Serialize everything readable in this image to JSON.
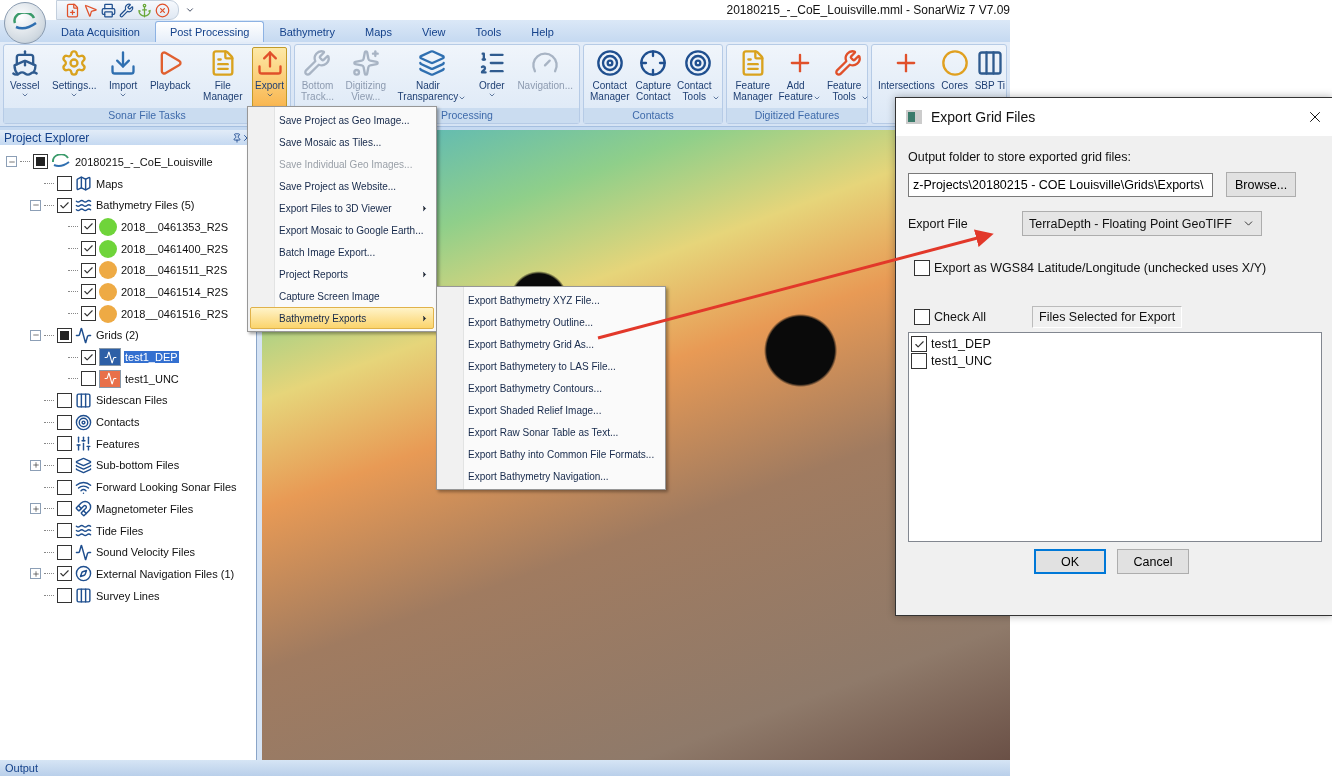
{
  "window": {
    "title": "20180215_-_CoE_Louisville.mml - SonarWiz 7 V7.09"
  },
  "tabs": [
    {
      "label": "Data Acquisition",
      "selected": false
    },
    {
      "label": "Post Processing",
      "selected": true
    },
    {
      "label": "Bathymetry",
      "selected": false
    },
    {
      "label": "Maps",
      "selected": false
    },
    {
      "label": "View",
      "selected": false
    },
    {
      "label": "Tools",
      "selected": false
    },
    {
      "label": "Help",
      "selected": false
    }
  ],
  "ribbon": [
    {
      "label": "Sonar File Tasks",
      "buttons": [
        {
          "label": "Vessel",
          "dropdown": true,
          "disabled": false,
          "active": false
        },
        {
          "label": "Settings...",
          "dropdown": true,
          "disabled": false,
          "active": false
        },
        {
          "label": "Import",
          "dropdown": true,
          "disabled": false,
          "active": false
        },
        {
          "label": "Playback",
          "dropdown": false,
          "disabled": false,
          "active": false
        },
        {
          "label": "File\nManager",
          "dropdown": false,
          "disabled": false,
          "active": false
        },
        {
          "label": "Export",
          "dropdown": true,
          "disabled": false,
          "active": true
        }
      ]
    },
    {
      "label": "Processing",
      "buttons": [
        {
          "label": "Bottom\nTrack...",
          "dropdown": false,
          "disabled": true,
          "active": false
        },
        {
          "label": "Digitizing\nView...",
          "dropdown": false,
          "disabled": true,
          "active": false
        },
        {
          "label": "Nadir\nTransparency",
          "dropdown": true,
          "disabled": false,
          "active": false
        },
        {
          "label": "Order",
          "dropdown": true,
          "disabled": false,
          "active": false
        },
        {
          "label": "Navigation...",
          "dropdown": false,
          "disabled": true,
          "active": false
        }
      ]
    },
    {
      "label": "Contacts",
      "buttons": [
        {
          "label": "Contact\nManager",
          "dropdown": false,
          "disabled": false,
          "active": false
        },
        {
          "label": "Capture\nContact",
          "dropdown": false,
          "disabled": false,
          "active": false
        },
        {
          "label": "Contact\nTools",
          "dropdown": true,
          "disabled": false,
          "active": false
        }
      ]
    },
    {
      "label": "Digitized Features",
      "buttons": [
        {
          "label": "Feature\nManager",
          "dropdown": false,
          "disabled": false,
          "active": false
        },
        {
          "label": "Add\nFeature",
          "dropdown": true,
          "disabled": false,
          "active": false
        },
        {
          "label": "Feature\nTools",
          "dropdown": true,
          "disabled": false,
          "active": false
        }
      ]
    },
    {
      "buttons": [
        {
          "label": "Intersections",
          "dropdown": false,
          "disabled": false,
          "active": false
        },
        {
          "label": "Cores",
          "dropdown": false,
          "disabled": false,
          "active": false
        },
        {
          "label": "SBP Ti",
          "dropdown": false,
          "disabled": false,
          "active": false
        }
      ]
    }
  ],
  "project_explorer": {
    "title": "Project Explorer",
    "tree": [
      {
        "label": "20180215_-_CoE_Louisville",
        "kind": "project",
        "checked": false,
        "mixed": true,
        "expanded": true,
        "selected": false,
        "children": [
          {
            "label": "Maps",
            "kind": "folder",
            "checked": false,
            "mixed": false,
            "selected": false
          },
          {
            "label": "Bathymetry Files (5)",
            "kind": "folder",
            "checked": true,
            "mixed": false,
            "expanded": true,
            "selected": false,
            "children": [
              {
                "label": "2018__0461353_R2S",
                "kind": "status",
                "color": "#6fd43a",
                "checked": true,
                "mixed": false,
                "selected": false
              },
              {
                "label": "2018__0461400_R2S",
                "kind": "status",
                "color": "#6fd43a",
                "checked": true,
                "mixed": false,
                "selected": false
              },
              {
                "label": "2018__0461511_R2S",
                "kind": "status",
                "color": "#eeaa44",
                "checked": true,
                "mixed": false,
                "selected": false
              },
              {
                "label": "2018__0461514_R2S",
                "kind": "status",
                "color": "#eeaa44",
                "checked": true,
                "mixed": false,
                "selected": false
              },
              {
                "label": "2018__0461516_R2S",
                "kind": "status",
                "color": "#eeaa44",
                "checked": true,
                "mixed": false,
                "selected": false
              }
            ]
          },
          {
            "label": "Grids (2)",
            "kind": "folder",
            "checked": false,
            "mixed": true,
            "expanded": true,
            "selected": false,
            "children": [
              {
                "label": "test1_DEP",
                "kind": "grid",
                "color": "#2d5fa6",
                "checked": true,
                "mixed": false,
                "selected": true
              },
              {
                "label": "test1_UNC",
                "kind": "grid",
                "color": "#e8704a",
                "checked": false,
                "mixed": false,
                "selected": false
              }
            ]
          },
          {
            "label": "Sidescan Files",
            "kind": "folder",
            "checked": false,
            "mixed": false,
            "selected": false
          },
          {
            "label": "Contacts",
            "kind": "folder",
            "checked": false,
            "mixed": false,
            "selected": false
          },
          {
            "label": "Features",
            "kind": "folder",
            "checked": false,
            "mixed": false,
            "selected": false
          },
          {
            "label": "Sub-bottom Files",
            "kind": "folder",
            "checked": false,
            "mixed": false,
            "expanded": false,
            "selected": false
          },
          {
            "label": "Forward Looking Sonar Files",
            "kind": "folder",
            "checked": false,
            "mixed": false,
            "selected": false
          },
          {
            "label": "Magnetometer Files",
            "kind": "folder",
            "checked": false,
            "mixed": false,
            "expanded": false,
            "selected": false
          },
          {
            "label": "Tide Files",
            "kind": "folder",
            "checked": false,
            "mixed": false,
            "selected": false
          },
          {
            "label": "Sound Velocity Files",
            "kind": "folder",
            "checked": false,
            "mixed": false,
            "selected": false
          },
          {
            "label": "External Navigation Files (1)",
            "kind": "folder",
            "checked": true,
            "mixed": false,
            "expanded": false,
            "selected": false
          },
          {
            "label": "Survey Lines",
            "kind": "folder",
            "checked": false,
            "mixed": false,
            "selected": false
          }
        ]
      }
    ]
  },
  "export_menu": [
    {
      "label": "Save Project as Geo Image...",
      "disabled": false,
      "submenu": false,
      "selected": false
    },
    {
      "label": "Save Mosaic as Tiles...",
      "disabled": false,
      "submenu": false,
      "selected": false
    },
    {
      "label": "Save Individual Geo Images...",
      "disabled": true,
      "submenu": false,
      "selected": false
    },
    {
      "label": "Save Project as Website...",
      "disabled": false,
      "submenu": false,
      "selected": false
    },
    {
      "label": "Export Files to 3D Viewer",
      "disabled": false,
      "submenu": true,
      "selected": false
    },
    {
      "label": "Export Mosaic to Google Earth...",
      "disabled": false,
      "submenu": false,
      "selected": false
    },
    {
      "label": "Batch Image Export...",
      "disabled": false,
      "submenu": false,
      "selected": false
    },
    {
      "label": "Project Reports",
      "disabled": false,
      "submenu": true,
      "selected": false
    },
    {
      "label": "Capture Screen Image",
      "disabled": false,
      "submenu": false,
      "selected": false
    },
    {
      "label": "Bathymetry Exports",
      "disabled": false,
      "submenu": true,
      "selected": true
    }
  ],
  "bathymetry_submenu": [
    {
      "label": "Export Bathymetry XYZ File...",
      "selected": false
    },
    {
      "label": "Export Bathymetry Outline...",
      "selected": false
    },
    {
      "label": "Export Bathymetry Grid As...",
      "selected": false
    },
    {
      "label": "Export Bathymetery to LAS File...",
      "selected": false
    },
    {
      "label": "Export Bathymetry Contours...",
      "selected": false
    },
    {
      "label": "Export Shaded Relief Image...",
      "selected": false
    },
    {
      "label": "Export Raw Sonar Table as Text...",
      "selected": false
    },
    {
      "label": "Export Bathy into Common File Formats...",
      "selected": false
    },
    {
      "label": "Export Bathymetry Navigation...",
      "selected": false
    }
  ],
  "dialog": {
    "title": "Export Grid Files",
    "folder_label": "Output folder to store exported grid files:",
    "folder_value": "z-Projects\\20180215 - COE Louisville\\Grids\\Exports\\",
    "browse": "Browse...",
    "export_file_label": "Export File",
    "export_file_value": "TerraDepth - Floating Point GeoTIFF",
    "wgs84": {
      "label": "Export as WGS84 Latitude/Longitude (unchecked uses X/Y)",
      "checked": false
    },
    "check_all": {
      "label": "Check All",
      "checked": false
    },
    "files_heading": "Files Selected for Export",
    "files": [
      {
        "label": "test1_DEP",
        "checked": true
      },
      {
        "label": "test1_UNC",
        "checked": false
      }
    ],
    "ok": "OK",
    "cancel": "Cancel"
  },
  "status_bar": {
    "title": "Output"
  }
}
